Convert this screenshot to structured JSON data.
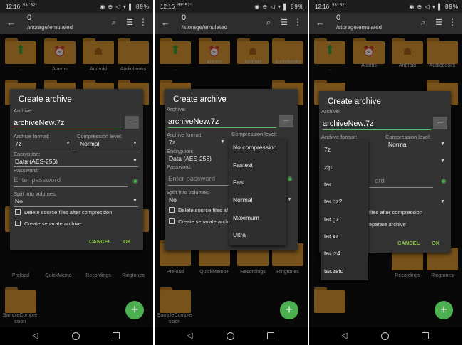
{
  "status": {
    "time": "12:16",
    "extra": "53° 52°",
    "battery": "89%",
    "icons": "◉ ⊖ ◁ ▾ ▌"
  },
  "toolbar": {
    "count": "0",
    "path": "/storage/emulated",
    "back_icon": "arrow-left-icon",
    "search_icon": "search-icon",
    "list_icon": "list-view-icon",
    "more_icon": "more-vert-icon"
  },
  "folders": {
    "row1": [
      "..",
      "Alarms",
      "Android",
      "Audiobooks"
    ],
    "row2_partial": [
      "bod",
      "fio"
    ],
    "row3": [
      "Preload",
      "QuickMemo+",
      "Recordings",
      "Ringtones"
    ],
    "row4": [
      "SampleCompre ssion"
    ]
  },
  "dialog": {
    "title": "Create archive",
    "archive_label": "Archive:",
    "archive_name": "archiveNew.7z",
    "browse_label": "...",
    "format_label": "Archive format:",
    "format_value": "7z",
    "compression_label": "Compression level:",
    "compression_value": "Normal",
    "encryption_label": "Encryption:",
    "encryption_value": "Data (AES-256)",
    "password_label": "Password:",
    "password_placeholder": "Enter password",
    "password_partial": "ord",
    "split_label": "Split into volumes:",
    "split_value": "No",
    "delete_source_label": "Delete source files after compression",
    "delete_source_partial": "Delete source files af",
    "delete_source_partial2": "files after compression",
    "separate_label": "Create separate archive",
    "separate_partial": "Create separate archi",
    "separate_partial2": "eparate archive",
    "cancel_label": "CANCEL",
    "ok_label": "OK"
  },
  "compression_menu": [
    "No compression",
    "Fastest",
    "Fast",
    "Normal",
    "Maximum",
    "Ultra"
  ],
  "format_menu": [
    "7z",
    "zip",
    "tar",
    "tar.bz2",
    "tar.gz",
    "tar.xz",
    "tar.lz4",
    "tar.zstd"
  ],
  "colors": {
    "folder": "#d99530",
    "accent": "#4caf50",
    "dialog": "#333333",
    "button_text": "#8bc34a"
  }
}
